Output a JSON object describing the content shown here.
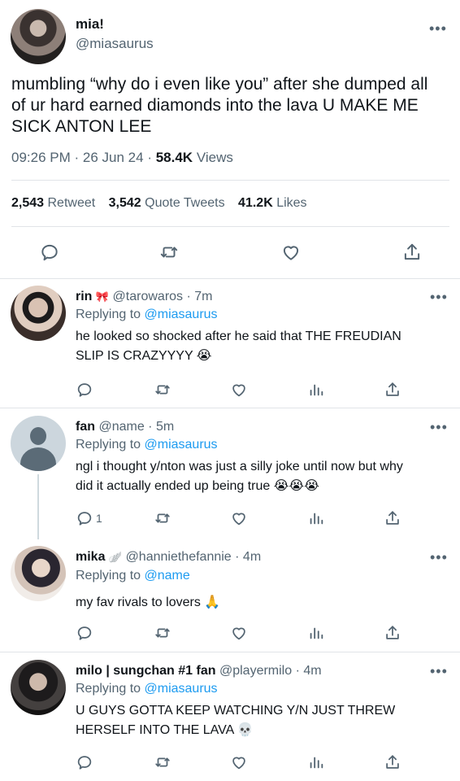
{
  "main_tweet": {
    "display_name": "mia!",
    "handle": "@miasaurus",
    "text_line1": "mumbling “why do i even like you” after she dumped all",
    "text_line2": "of ur hard earned diamonds into the lava U MAKE ME",
    "text_line3": "SICK ANTON LEE",
    "time": "09:26 PM",
    "date": "26 Jun 24",
    "views_count": "58.4K",
    "views_label": "Views",
    "retweet_count": "2,543",
    "retweet_label": "Retweet",
    "quote_count": "3,542",
    "quote_label": "Quote Tweets",
    "likes_count": "41.2K",
    "likes_label": "Likes"
  },
  "replies": [
    {
      "display_name": "rin",
      "emoji": "🎀",
      "handle": "@tarowaros",
      "age": "7m",
      "replying_prefix": "Replying to",
      "replying_to": "@miasaurus",
      "line1": "he looked so shocked after he said that THE FREUDIAN",
      "line2": "SLIP IS CRAZYYYY 😭",
      "reply_count": ""
    },
    {
      "display_name": "fan",
      "emoji": "",
      "handle": "@name",
      "age": "5m",
      "replying_prefix": "Replying to",
      "replying_to": "@miasaurus",
      "line1": "ngl i thought y/nton was just a silly joke until now but why",
      "line2": "did it actually ended up being true 😭😭😭",
      "reply_count": "1"
    },
    {
      "display_name": "mika",
      "emoji": "🪽",
      "handle": "@hanniethefannie",
      "age": "4m",
      "replying_prefix": "Replying to",
      "replying_to": "@name",
      "line1": "my fav rivals to lovers 🙏",
      "line2": "",
      "reply_count": ""
    },
    {
      "display_name": "milo | sungchan #1 fan",
      "emoji": "",
      "handle": "@playermilo",
      "age": "4m",
      "replying_prefix": "Replying to",
      "replying_to": "@miasaurus",
      "line1": "U GUYS GOTTA KEEP WATCHING Y/N JUST THREW",
      "line2": "HERSELF INTO THE LAVA 💀",
      "reply_count": ""
    }
  ],
  "colors": {
    "text": "#0f1419",
    "secondary": "#536471",
    "link": "#1d9bf0",
    "divider": "#e1e4e8"
  },
  "icons": [
    "more-icon",
    "reply-icon",
    "retweet-icon",
    "like-icon",
    "share-icon",
    "analytics-icon"
  ]
}
